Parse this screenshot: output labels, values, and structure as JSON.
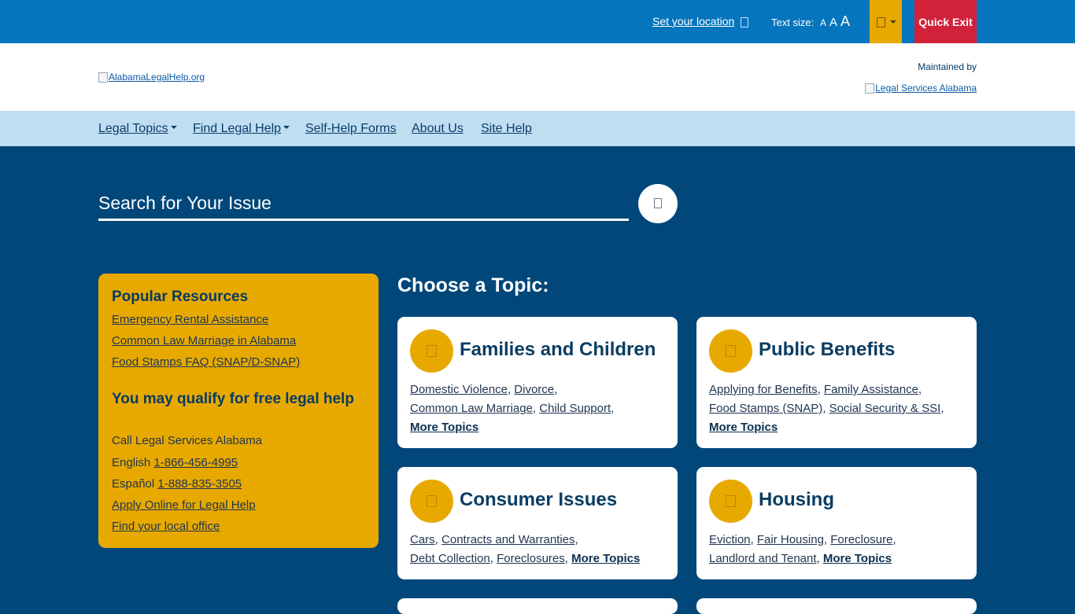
{
  "topbar": {
    "location_label": "Set your location",
    "text_size_label": "Text size:",
    "text_sizes": [
      "A",
      "A",
      "A"
    ],
    "quick_exit_label": "Quick Exit"
  },
  "header": {
    "logo_alt": "AlabamaLegalHelp.org",
    "maintained_label": "Maintained by",
    "maintainer_logo_alt": "Legal Services Alabama"
  },
  "nav": {
    "items": [
      {
        "label": "Legal Topics",
        "dropdown": true
      },
      {
        "label": "Find Legal Help",
        "dropdown": true
      },
      {
        "label": "Self-Help Forms",
        "dropdown": false
      },
      {
        "label": "About Us",
        "dropdown": false
      },
      {
        "label": "Site Help",
        "dropdown": false
      }
    ]
  },
  "search": {
    "placeholder": "Search for Your Issue"
  },
  "popular": {
    "title": "Popular Resources",
    "links": [
      "Emergency Rental Assistance",
      "Common Law Marriage in Alabama",
      "Food Stamps FAQ (SNAP/D-SNAP)"
    ],
    "qualify_title": "You may qualify for free legal help",
    "call_text": "Call Legal Services Alabama",
    "english_label": "English",
    "english_phone": "1-866-456-4995",
    "spanish_label": "Español",
    "spanish_phone": "1-888-835-3505",
    "apply_link": "Apply Online for Legal Help",
    "office_link": "Find your local office"
  },
  "topics": {
    "title": "Choose a Topic:",
    "cards": [
      {
        "title": "Families and Children",
        "links": [
          "Domestic Violence",
          "Divorce",
          "Common Law Marriage",
          "Child Support"
        ],
        "more": "More Topics"
      },
      {
        "title": "Public Benefits",
        "links": [
          "Applying for Benefits",
          "Family Assistance",
          "Food Stamps (SNAP)",
          "Social Security & SSI"
        ],
        "more": "More Topics"
      },
      {
        "title": "Consumer Issues",
        "links": [
          "Cars",
          "Contracts and Warranties",
          "Debt Collection",
          "Foreclosures"
        ],
        "more": "More Topics"
      },
      {
        "title": "Housing",
        "links": [
          "Eviction",
          "Fair Housing",
          "Foreclosure",
          "Landlord and Tenant"
        ],
        "more": "More Topics"
      }
    ]
  },
  "colors": {
    "topbar": "#0575bd",
    "nav": "#c0def2",
    "page_bg": "#02477a",
    "accent": "#e7a900",
    "quick_exit": "#d2213b"
  },
  "icons": {
    "location": "map-marker-icon",
    "language": "globe-icon",
    "search": "search-icon",
    "families": "family-icon",
    "benefits": "benefits-icon",
    "consumer": "shopping-icon",
    "housing": "house-icon"
  }
}
